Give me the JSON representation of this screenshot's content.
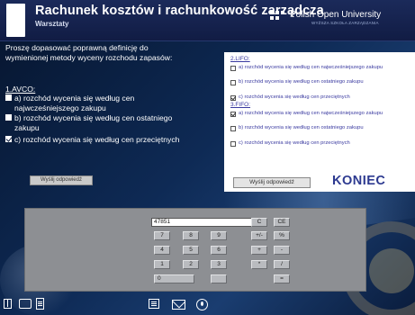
{
  "header": {
    "title": "Rachunek kosztów i rachunkowość zarządcza",
    "subtitle": "Warsztaty",
    "university": "Polish Open University",
    "university_sub": "WYŻSZA SZKOŁA ZARZĄDZANIA"
  },
  "question": {
    "text": "Proszę dopasować poprawną definicję do wymienionej metody wyceny rozchodu zapasów:",
    "section": "1.AVCO:",
    "options": [
      {
        "label": "a) rozchód wycenia się według cen najwcześniejszego zakupu",
        "checked": false
      },
      {
        "label": "b) rozchód wycenia się według cen ostatniego zakupu",
        "checked": false
      },
      {
        "label": "c) rozchód wycenia się według cen przeciętnych",
        "checked": true
      }
    ],
    "submit_label": "Wyślij odpowiedź"
  },
  "panel": {
    "sections": [
      {
        "title": "2.LIFO:",
        "options": [
          {
            "label": "a) rozchód wycenia się według cen najwcześniejszego zakupu",
            "checked": false
          },
          {
            "label": "b) rozchód wycenia się według cen ostatniego zakupu",
            "checked": false
          },
          {
            "label": "c) rozchód wycenia się według cen przeciętnych",
            "checked": true
          }
        ]
      },
      {
        "title": "3.FIFO:",
        "options": [
          {
            "label": "a) rozchód wycenia się według cen najwcześniejszego zakupu",
            "checked": true
          },
          {
            "label": "b) rozchód wycenia się według cen ostatniego zakupu",
            "checked": false
          },
          {
            "label": "c) rozchód wycenia się według cen przeciętnych",
            "checked": false
          }
        ]
      }
    ],
    "submit_label": "Wyślij odpowiedź",
    "end_label": "KONIEC"
  },
  "calculator": {
    "display": "47851",
    "keys": [
      "C",
      "CE",
      "7",
      "8",
      "9",
      "+/-",
      "%",
      "4",
      "5",
      "6",
      "+",
      "-",
      "1",
      "2",
      "3",
      "*",
      "/",
      "0",
      "",
      "="
    ]
  },
  "bottom_icons": [
    "book-icon",
    "people-icon",
    "document-icon",
    "list-icon",
    "mail-icon",
    "power-icon"
  ],
  "colors": {
    "header_bg": "#1b2a5a",
    "panel_text": "#3a3aa0",
    "calc_bg": "#8d8f93"
  }
}
